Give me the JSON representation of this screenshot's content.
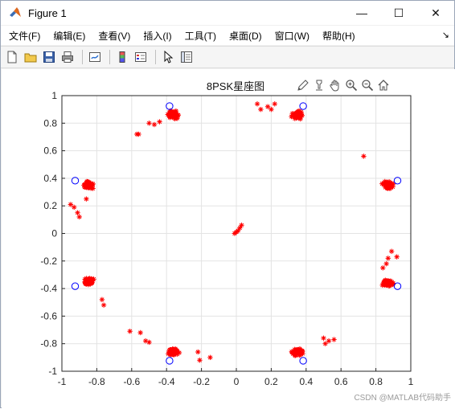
{
  "window": {
    "title": "Figure 1",
    "controls": {
      "minimize": "—",
      "maximize": "☐",
      "close": "✕"
    }
  },
  "menu": {
    "items": [
      "文件(F)",
      "编辑(E)",
      "查看(V)",
      "插入(I)",
      "工具(T)",
      "桌面(D)",
      "窗口(W)",
      "帮助(H)"
    ],
    "overflow": "↘"
  },
  "toolbar": {
    "icons": [
      "new-figure-icon",
      "open-file-icon",
      "save-icon",
      "print-icon",
      "link-plot-icon",
      "colorbar-icon",
      "legend-icon",
      "pointer-icon",
      "property-inspector-icon"
    ]
  },
  "axes_toolbar": {
    "icons": [
      "brush-icon",
      "data-tips-icon",
      "pan-icon",
      "zoom-in-icon",
      "zoom-out-icon",
      "home-icon"
    ]
  },
  "watermark": "CSDN @MATLAB代码助手",
  "chart_data": {
    "type": "scatter",
    "title": "8PSK星座图",
    "xlabel": "",
    "ylabel": "",
    "xlim": [
      -1,
      1
    ],
    "ylim": [
      -1,
      1
    ],
    "xticks": [
      "-1",
      "-0.8",
      "-0.6",
      "-0.4",
      "-0.2",
      "0",
      "0.2",
      "0.4",
      "0.6",
      "0.8",
      "1"
    ],
    "yticks": [
      "-1",
      "-0.8",
      "-0.6",
      "-0.4",
      "-0.2",
      "0",
      "0.2",
      "0.4",
      "0.6",
      "0.8",
      "1"
    ],
    "grid": true,
    "series": [
      {
        "marker": "o",
        "color": "#0000ff",
        "points": [
          [
            0.924,
            0.383
          ],
          [
            0.383,
            0.924
          ],
          [
            -0.383,
            0.924
          ],
          [
            -0.924,
            0.383
          ],
          [
            -0.924,
            -0.383
          ],
          [
            -0.383,
            -0.924
          ],
          [
            0.383,
            -0.924
          ],
          [
            0.924,
            -0.383
          ]
        ]
      },
      {
        "marker": "*",
        "color": "#ff0000",
        "cluster_centers": [
          [
            0.87,
            0.35
          ],
          [
            0.35,
            0.86
          ],
          [
            -0.36,
            0.86
          ],
          [
            -0.85,
            0.35
          ],
          [
            -0.85,
            -0.35
          ],
          [
            -0.36,
            -0.86
          ],
          [
            0.35,
            -0.86
          ],
          [
            0.87,
            -0.36
          ]
        ],
        "outliers": [
          [
            0.12,
            0.94
          ],
          [
            0.14,
            0.9
          ],
          [
            0.18,
            0.92
          ],
          [
            0.2,
            0.9
          ],
          [
            0.22,
            0.94
          ],
          [
            -0.47,
            0.79
          ],
          [
            -0.5,
            0.8
          ],
          [
            -0.44,
            0.81
          ],
          [
            -0.56,
            0.72
          ],
          [
            -0.57,
            0.72
          ],
          [
            0.73,
            0.56
          ],
          [
            -0.95,
            0.21
          ],
          [
            -0.93,
            0.19
          ],
          [
            -0.91,
            0.15
          ],
          [
            -0.9,
            0.12
          ],
          [
            -0.86,
            0.25
          ],
          [
            0.0,
            0.01
          ],
          [
            0.01,
            0.02
          ],
          [
            0.02,
            0.04
          ],
          [
            0.03,
            0.06
          ],
          [
            -0.01,
            0.0
          ],
          [
            0.89,
            -0.13
          ],
          [
            0.87,
            -0.18
          ],
          [
            0.92,
            -0.17
          ],
          [
            0.86,
            -0.22
          ],
          [
            0.84,
            -0.25
          ],
          [
            -0.77,
            -0.48
          ],
          [
            -0.76,
            -0.52
          ],
          [
            -0.61,
            -0.71
          ],
          [
            -0.55,
            -0.72
          ],
          [
            -0.52,
            -0.78
          ],
          [
            -0.5,
            -0.79
          ],
          [
            -0.22,
            -0.86
          ],
          [
            -0.21,
            -0.92
          ],
          [
            -0.15,
            -0.9
          ],
          [
            0.5,
            -0.76
          ],
          [
            0.51,
            -0.8
          ],
          [
            0.53,
            -0.78
          ],
          [
            0.56,
            -0.77
          ]
        ]
      }
    ]
  }
}
